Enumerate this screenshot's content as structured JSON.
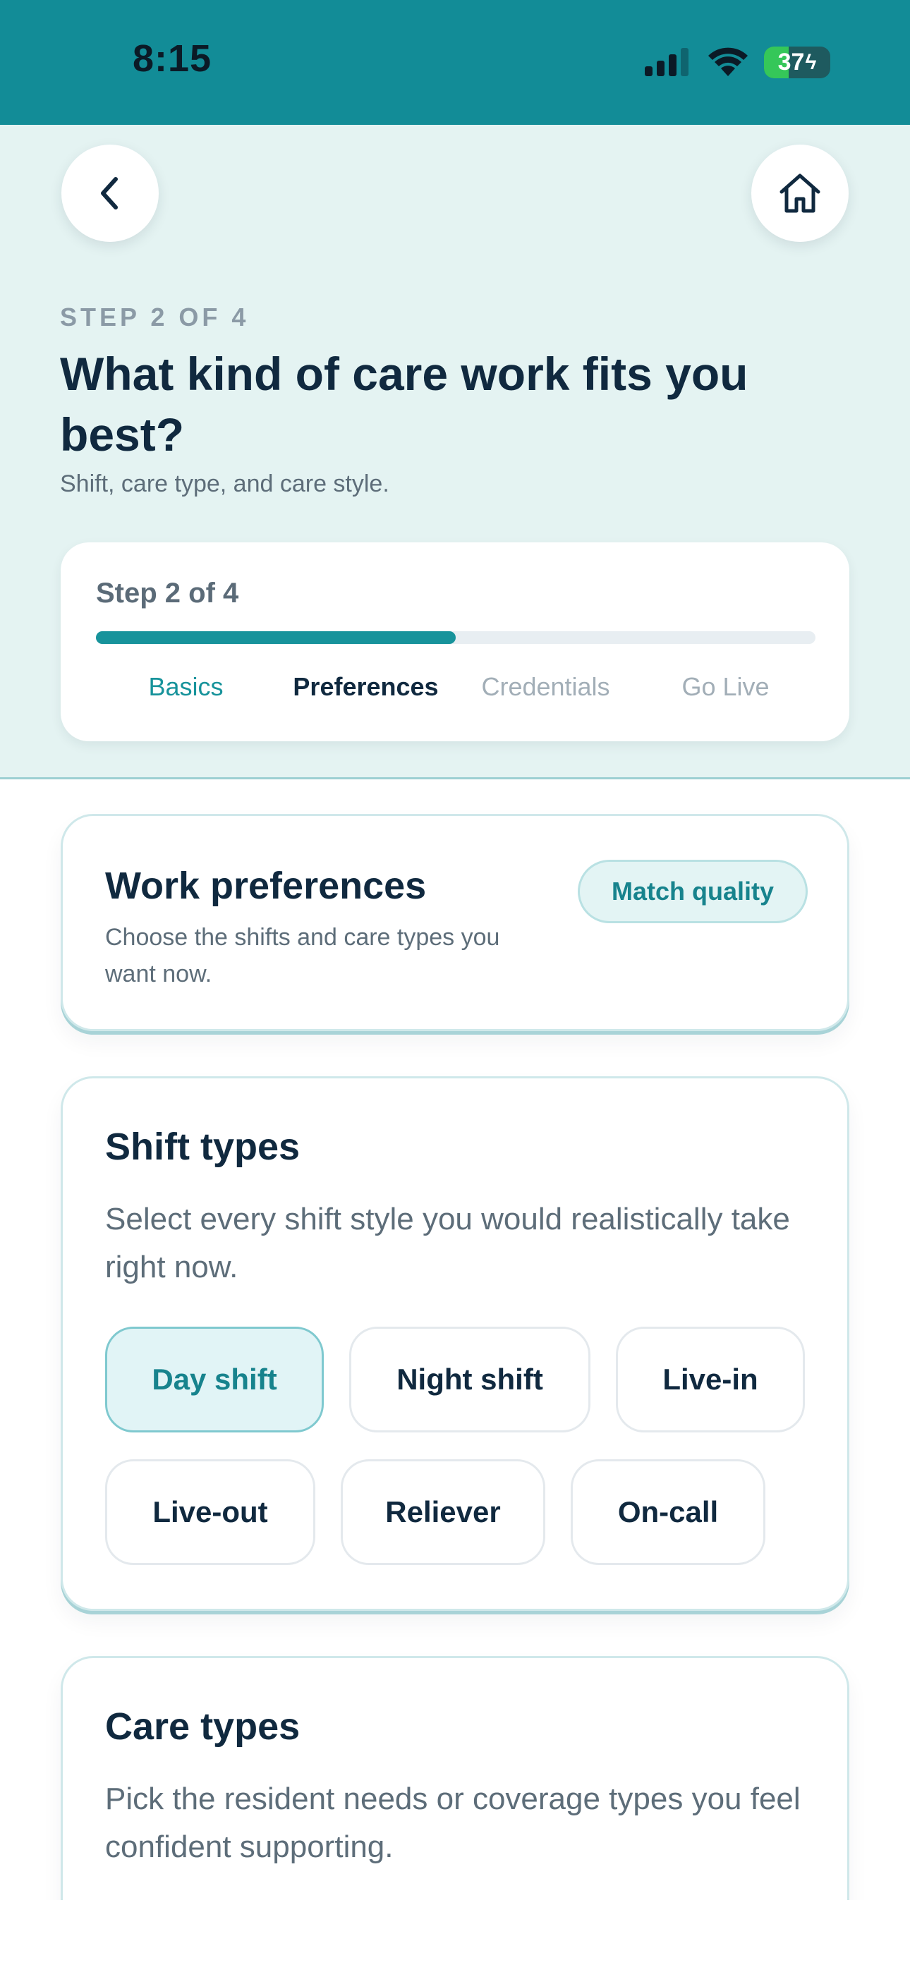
{
  "status_bar": {
    "time": "8:15",
    "battery_level": "37",
    "battery_fraction": 0.37,
    "icons": [
      "cellular-signal-icon",
      "wifi-icon",
      "battery-charging-icon"
    ],
    "background": "#128c97"
  },
  "nav": {
    "back_icon": "chevron-left-icon",
    "home_icon": "home-icon"
  },
  "header": {
    "step_label": "STEP 2 OF 4",
    "title": "What kind of care work fits you best?",
    "subtitle": "Shift, care type, and care style."
  },
  "progress": {
    "label": "Step 2 of 4",
    "fraction": 0.5,
    "steps": [
      {
        "label": "Basics",
        "state": "done"
      },
      {
        "label": "Preferences",
        "state": "active"
      },
      {
        "label": "Credentials",
        "state": "upcoming"
      },
      {
        "label": "Go Live",
        "state": "upcoming"
      }
    ],
    "accent": "#17939b"
  },
  "work_preferences": {
    "title": "Work preferences",
    "description": "Choose the shifts and care types you want now.",
    "badge": "Match quality"
  },
  "shift_types": {
    "title": "Shift types",
    "description": "Select every shift style you would realistically take right now.",
    "options": [
      {
        "label": "Day shift",
        "selected": true
      },
      {
        "label": "Night shift",
        "selected": false
      },
      {
        "label": "Live-in",
        "selected": false
      },
      {
        "label": "Live-out",
        "selected": false
      },
      {
        "label": "Reliever",
        "selected": false
      },
      {
        "label": "On-call",
        "selected": false
      }
    ]
  },
  "care_types": {
    "title": "Care types",
    "description": "Pick the resident needs or coverage types you feel confident supporting."
  }
}
